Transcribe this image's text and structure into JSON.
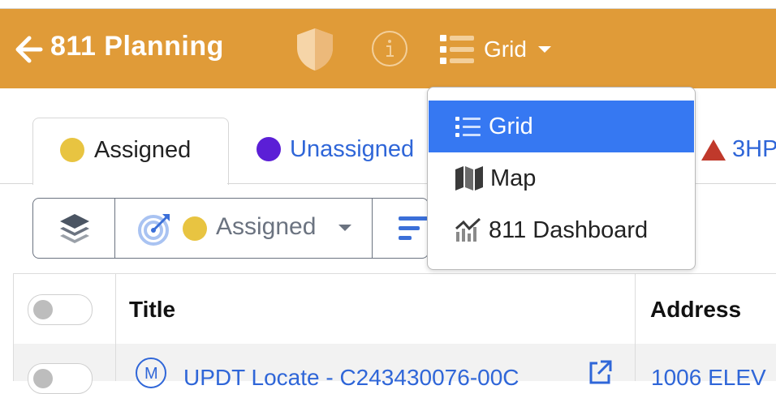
{
  "header": {
    "title": "811 Planning",
    "view_label": "Grid",
    "brand_color": "#e09b38"
  },
  "tabs": [
    {
      "label": "Assigned",
      "dot_color": "#e8c441"
    },
    {
      "label": "Unassigned",
      "dot_color": "#5b1fd6"
    },
    {
      "label": "3HP",
      "icon": "warning-triangle-icon"
    }
  ],
  "toolbar": {
    "status_label": "Assigned"
  },
  "view_menu": {
    "items": [
      {
        "label": "Grid",
        "icon": "list-icon",
        "selected": true
      },
      {
        "label": "Map",
        "icon": "map-icon",
        "selected": false
      },
      {
        "label": "811 Dashboard",
        "icon": "chart-icon",
        "selected": false
      }
    ]
  },
  "table": {
    "columns": [
      "Title",
      "Address"
    ],
    "rows": [
      {
        "title_prefix": "M",
        "title": "UPDT Locate - C243430076-00C",
        "address": "1006 ELEV"
      }
    ]
  }
}
